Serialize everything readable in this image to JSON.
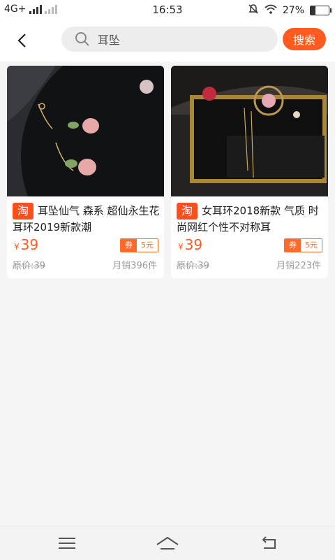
{
  "status_bar": {
    "network": "4G+",
    "time": "16:53",
    "battery": "27%",
    "battery_level": 0.27,
    "icons": [
      "signal-icon",
      "alarm-off-icon",
      "wifi-icon",
      "battery-icon"
    ]
  },
  "header": {
    "back_icon": "back-chevron-icon",
    "search_icon": "search-icon",
    "search_value": "耳坠",
    "search_button": "搜索"
  },
  "products": [
    {
      "badge": "淘",
      "title": "耳坠仙气 森系 超仙永生花耳环2019新款潮",
      "currency": "¥",
      "price": "39",
      "coupon_label": "券",
      "coupon_value": "5元",
      "original_price": "原价:39",
      "monthly_sales": "月销396件"
    },
    {
      "badge": "淘",
      "title": "女耳环2018新款 气质 时尚网红个性不对称耳",
      "currency": "¥",
      "price": "39",
      "coupon_label": "券",
      "coupon_value": "5元",
      "original_price": "原价:39",
      "monthly_sales": "月销223件"
    }
  ],
  "navigation": {
    "icons": [
      "menu-icon",
      "home-icon",
      "back-icon"
    ]
  },
  "colors": {
    "accent": "#ff5a1f",
    "background": "#f5f5f5"
  }
}
